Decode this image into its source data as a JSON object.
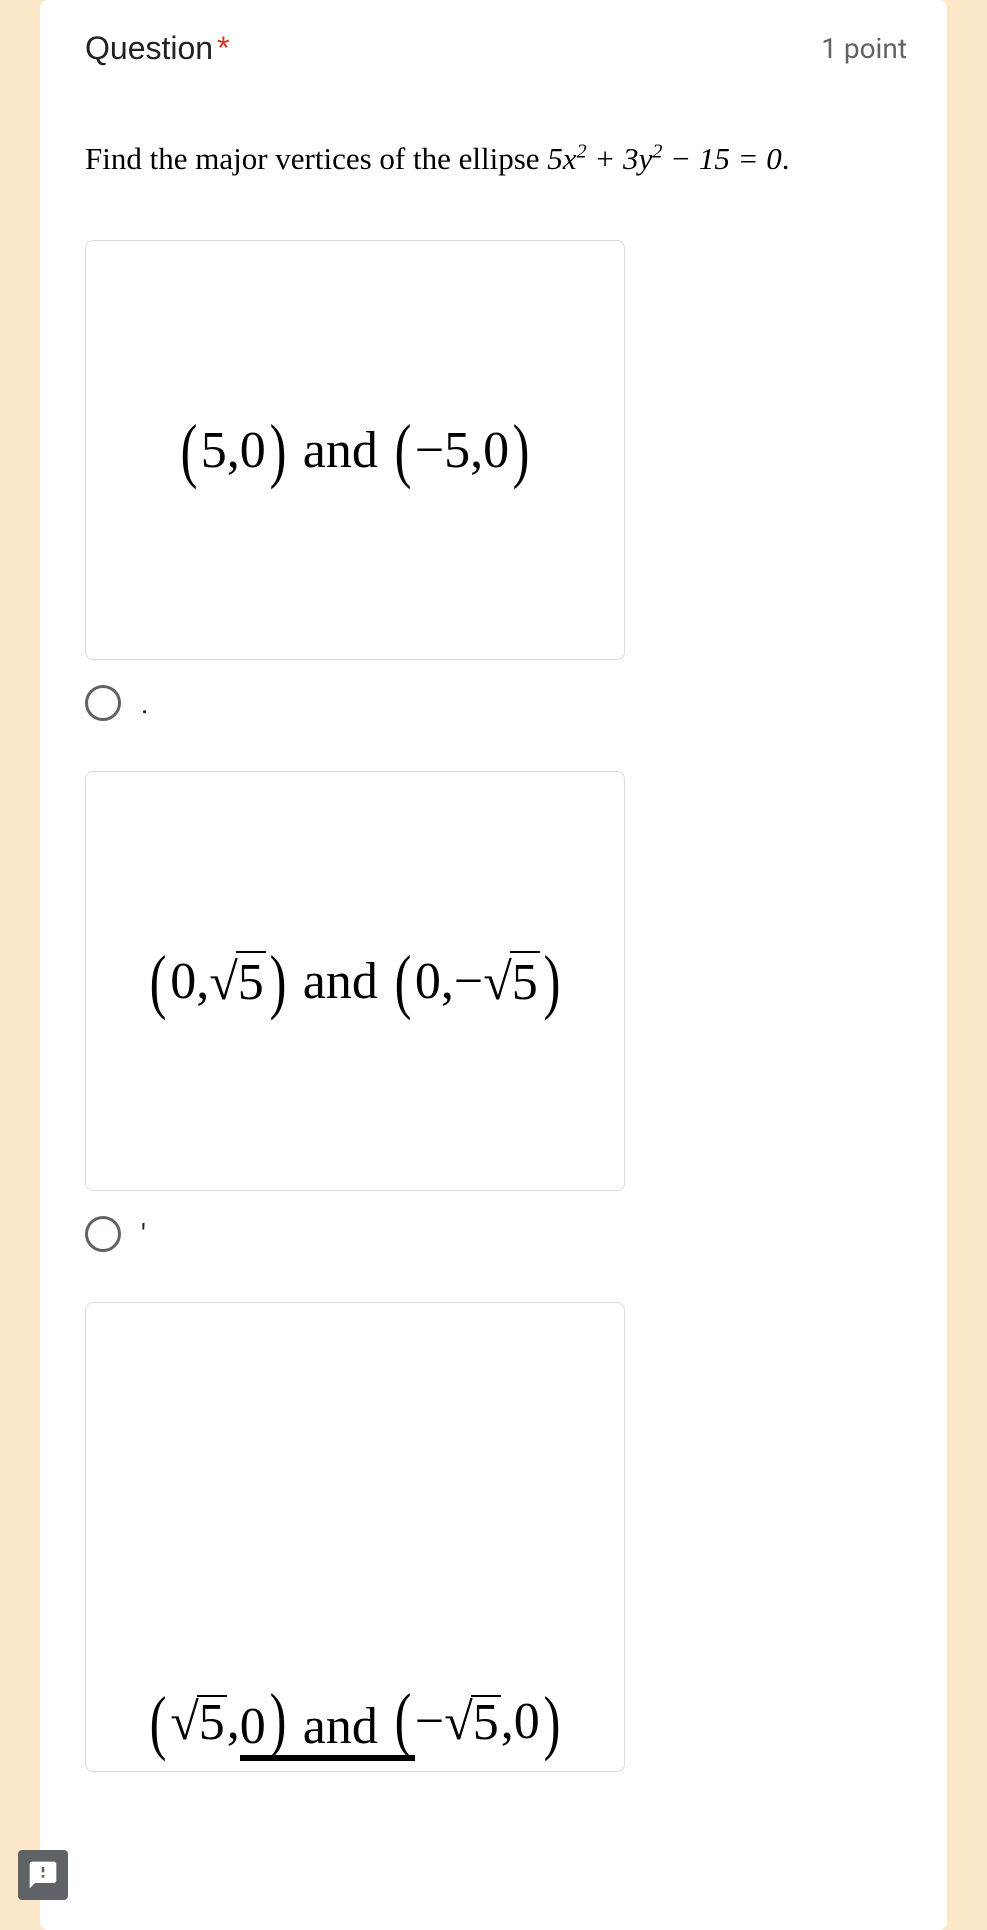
{
  "header": {
    "question_label": "Question",
    "required_mark": "*",
    "points": "1 point"
  },
  "question": {
    "prompt_prefix": "Find the major vertices of the ellipse ",
    "equation_plain": "5x² + 3y² − 15 = 0",
    "prompt_suffix": "."
  },
  "options": [
    {
      "content": "(5,0) and (−5,0)",
      "radio_label": "."
    },
    {
      "content": "(0,√5) and (0,−√5)",
      "radio_label": "'"
    },
    {
      "content": "(√5,0) and (−√5,0)",
      "radio_label": ""
    }
  ]
}
